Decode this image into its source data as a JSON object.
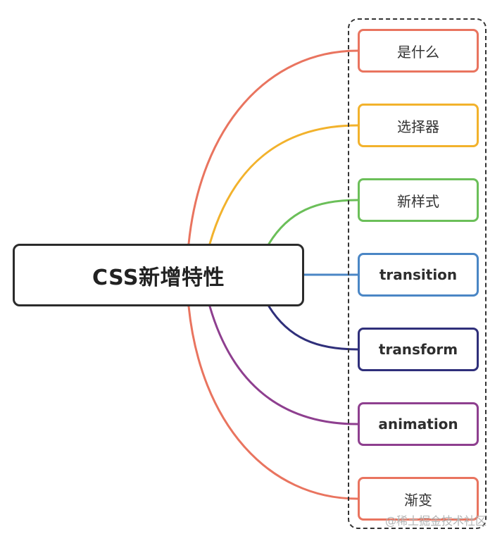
{
  "root": {
    "label": "CSS新增特性"
  },
  "children": [
    {
      "label": "是什么",
      "color": "#e9745f",
      "lang": "zh"
    },
    {
      "label": "选择器",
      "color": "#f2b22c",
      "lang": "zh"
    },
    {
      "label": "新样式",
      "color": "#6bbf59",
      "lang": "zh"
    },
    {
      "label": "transition",
      "color": "#4a86c5",
      "lang": "en"
    },
    {
      "label": "transform",
      "color": "#2f2f7a",
      "lang": "en"
    },
    {
      "label": "animation",
      "color": "#8e3f8f",
      "lang": "en"
    },
    {
      "label": "渐变",
      "color": "#e9745f",
      "lang": "zh"
    }
  ],
  "watermark": "@稀土掘金技术社区"
}
